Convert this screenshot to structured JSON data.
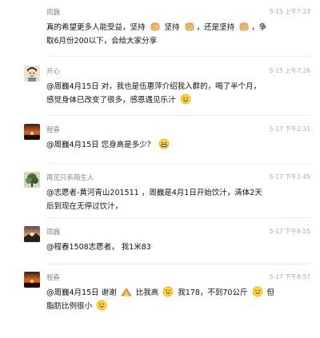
{
  "comments": [
    {
      "name": "周巍",
      "time": "5-15 上午7:23",
      "lines": [
        "真的希望更多人能受益，坚持 [fist] 坚持 [fist]，还是坚持 [fist]，争",
        "取6月份200以下，会给大家分享"
      ],
      "avatar": "none"
    },
    {
      "name": "开心",
      "time": "5-15 上午7:26",
      "lines": [
        "@周巍4月15日 对，我也是伍惠萍介绍我入群的，喝了半个月，",
        "感觉身体已改变了很多，感恩遇见乐汁 [smile]"
      ],
      "avatar": "cartoon"
    },
    {
      "name": "程春",
      "time": "5-17 下午2:31",
      "lines": [
        "@周巍4月15日 您身高是多少？ [grin]"
      ],
      "avatar": "sunset"
    },
    {
      "name": "再见只系陌生人",
      "time": "5-17 下午2:45",
      "lines": [
        "@志愿者-黄河青山201511 ，周巍是4月1日开始饮汁，清体2天",
        "后到现在无停过饮汁，"
      ],
      "avatar": "forest"
    },
    {
      "name": "周巍",
      "time": "5-17 下午8:55",
      "lines": [
        "@程春1508志愿者， 我1米83"
      ],
      "avatar": "sunrise"
    },
    {
      "name": "程春",
      "time": "5-17 下午8:57",
      "lines": [
        "@周巍4月15日 谢谢 [bow] 比我高 [tongue] 我178，不到70公斤 [tongue] 但",
        "脂肪比例很小 [tongue]"
      ],
      "avatar": "sunset"
    }
  ],
  "icons": {
    "fist": "fist-emoji-icon",
    "smile": "smile-emoji-icon",
    "grin": "grin-emoji-icon",
    "bow": "bow-emoji-icon",
    "tongue": "tongue-emoji-icon"
  }
}
